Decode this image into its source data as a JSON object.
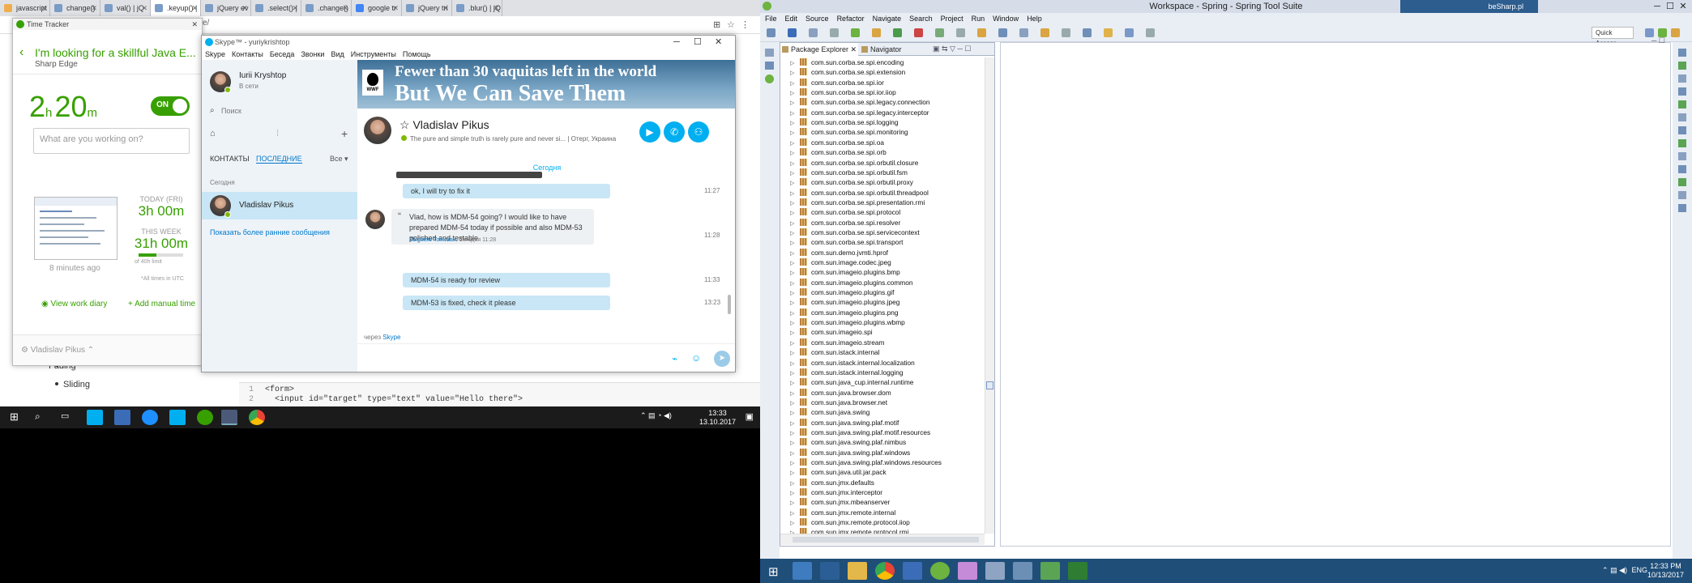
{
  "browser": {
    "tabs": [
      {
        "label": "javascript",
        "color": "#f0ad4e"
      },
      {
        "label": "change()",
        "color": "#7a9cc6"
      },
      {
        "label": "val() | jQ",
        "color": "#7a9cc6"
      },
      {
        "label": ".keyup() |",
        "color": "#7a9cc6"
      },
      {
        "label": "jQuery ev",
        "color": "#7a9cc6"
      },
      {
        "label": ".select() |",
        "color": "#7a9cc6"
      },
      {
        "label": ".change()",
        "color": "#7a9cc6"
      },
      {
        "label": "google tr",
        "color": "#4285f4"
      },
      {
        "label": "jQuery tri",
        "color": "#7a9cc6"
      },
      {
        "label": ".blur() | jQ",
        "color": "#7a9cc6"
      }
    ],
    "url_fragment": "e/"
  },
  "time_tracker": {
    "window_title": "Time Tracker",
    "job_title": "I'm looking for a skillful Java E...",
    "client": "Sharp Edge",
    "timer_hours": "2",
    "timer_hours_unit": "h",
    "timer_minutes": "20",
    "timer_minutes_unit": "m",
    "toggle_label": "ON",
    "work_placeholder": "What are you working on?",
    "screenshot_age": "8 minutes ago",
    "today_label": "TODAY (FRI)",
    "today_value": "3h 00m",
    "week_label": "THIS WEEK",
    "week_value": "31h 00m",
    "week_progress": 0.4,
    "week_limit": "of 40h limit",
    "timezone_note": "*All times in UTC",
    "view_diary": "View work diary",
    "add_manual": "Add manual time",
    "footer_user": "Vladislav Pikus"
  },
  "page_behind": {
    "items": [
      "Fading",
      "Sliding"
    ],
    "code_lines": [
      {
        "num": "1",
        "code": "<form>"
      },
      {
        "num": "2",
        "code": "  <input id=\"target\" type=\"text\" value=\"Hello there\">"
      }
    ]
  },
  "skype": {
    "window_title": "Skype™ - yuriykrishtop",
    "menu": [
      "Skype",
      "Контакты",
      "Беседа",
      "Звонки",
      "Вид",
      "Инструменты",
      "Помощь"
    ],
    "user_name": "Iurii Kryshtop",
    "user_status": "В сети",
    "search_placeholder": "Поиск",
    "tab_contacts": "КОНТАКТЫ",
    "tab_recent": "ПОСЛЕДНИЕ",
    "filter": "Все ▾",
    "today_header": "Сегодня",
    "conversation_name": "Vladislav Pikus",
    "show_older": "Показать более ранние сообщения",
    "ad_line1": "Fewer than 30 vaquitas left in the world",
    "ad_line2": "But We Can Save Them",
    "ad_logo": "WWF",
    "chat_name": "Vladislav Pikus",
    "chat_mood": "The pure and simple truth is rarely pure and never si...  |  Отерг, Украина",
    "date_divider": "Сегодня",
    "messages": [
      {
        "text": "ok, I will try to fix it",
        "time": "11:27"
      },
      {
        "text": "Vlad, how is MDM-54 going? I would like to have prepared MDM-54 today if possible and also MDM-53 polished and testable",
        "time": "11:28",
        "sender": "Zbigniew Tomczak",
        "sender_time": ", Сегодня 11:28"
      },
      {
        "text": "MDM-54 is ready for review",
        "time": "11:33"
      },
      {
        "text": "MDM-53 is fixed, check it please",
        "time": "13:23"
      }
    ],
    "via_label": "через",
    "via_app": "Skype"
  },
  "left_taskbar": {
    "time": "13:33",
    "date": "13.10.2017"
  },
  "sts": {
    "window_title": "Workspace - Spring - Spring Tool Suite",
    "menu": [
      "File",
      "Edit",
      "Source",
      "Refactor",
      "Navigate",
      "Search",
      "Project",
      "Run",
      "Window",
      "Help"
    ],
    "quick_access": "Quick Access",
    "tab_package_explorer": "Package Explorer",
    "tab_navigator": "Navigator",
    "packages": [
      "com.sun.corba.se.spi.encoding",
      "com.sun.corba.se.spi.extension",
      "com.sun.corba.se.spi.ior",
      "com.sun.corba.se.spi.ior.iiop",
      "com.sun.corba.se.spi.legacy.connection",
      "com.sun.corba.se.spi.legacy.interceptor",
      "com.sun.corba.se.spi.logging",
      "com.sun.corba.se.spi.monitoring",
      "com.sun.corba.se.spi.oa",
      "com.sun.corba.se.spi.orb",
      "com.sun.corba.se.spi.orbutil.closure",
      "com.sun.corba.se.spi.orbutil.fsm",
      "com.sun.corba.se.spi.orbutil.proxy",
      "com.sun.corba.se.spi.orbutil.threadpool",
      "com.sun.corba.se.spi.presentation.rmi",
      "com.sun.corba.se.spi.protocol",
      "com.sun.corba.se.spi.resolver",
      "com.sun.corba.se.spi.servicecontext",
      "com.sun.corba.se.spi.transport",
      "com.sun.demo.jvmti.hprof",
      "com.sun.image.codec.jpeg",
      "com.sun.imageio.plugins.bmp",
      "com.sun.imageio.plugins.common",
      "com.sun.imageio.plugins.gif",
      "com.sun.imageio.plugins.jpeg",
      "com.sun.imageio.plugins.png",
      "com.sun.imageio.plugins.wbmp",
      "com.sun.imageio.spi",
      "com.sun.imageio.stream",
      "com.sun.istack.internal",
      "com.sun.istack.internal.localization",
      "com.sun.istack.internal.logging",
      "com.sun.java_cup.internal.runtime",
      "com.sun.java.browser.dom",
      "com.sun.java.browser.net",
      "com.sun.java.swing",
      "com.sun.java.swing.plaf.motif",
      "com.sun.java.swing.plaf.motif.resources",
      "com.sun.java.swing.plaf.nimbus",
      "com.sun.java.swing.plaf.windows",
      "com.sun.java.swing.plaf.windows.resources",
      "com.sun.java.util.jar.pack",
      "com.sun.jmx.defaults",
      "com.sun.jmx.interceptor",
      "com.sun.jmx.mbeanserver",
      "com.sun.jmx.remote.internal",
      "com.sun.jmx.remote.protocol.iiop",
      "com.sun.jmx.remote.protocol.rmi"
    ]
  },
  "right_taskbar": {
    "lang": "ENG",
    "time": "12:33 PM",
    "date": "10/13/2017",
    "bg_text": "beSharp.pl"
  }
}
